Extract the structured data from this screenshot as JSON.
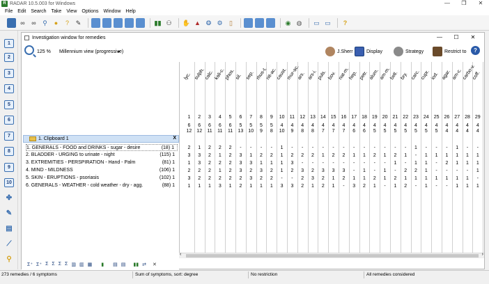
{
  "app": {
    "title": "RADAR 10.5.003 for Windows",
    "minimize": "—",
    "maximize": "❐",
    "close": "✕"
  },
  "menu": [
    "File",
    "Edit",
    "Search",
    "Take",
    "View",
    "Options",
    "Window",
    "Help"
  ],
  "window": {
    "title": "Investigation window for remedies",
    "minimize": "—",
    "maximize": "☐",
    "close": "✕"
  },
  "tools": {
    "zoom": "125 %",
    "view_mode": "Millennium view (progressive)",
    "view_caret": "▾",
    "user": "J.Sherr",
    "display": "Display",
    "strategy": "Strategy",
    "restrict": "Restrict to",
    "help": "?"
  },
  "left_numbers": [
    "1",
    "2",
    "3",
    "4",
    "5",
    "6",
    "7",
    "8",
    "9",
    "10"
  ],
  "clipboard": {
    "title": "1. Clipboard 1",
    "close": "X",
    "rubrics": [
      {
        "text": "1. GENERALS - FOOD and DRINKS - sugar - desire",
        "count": "(18) 1"
      },
      {
        "text": "2. BLADDER - URGING to urinate - night",
        "count": "(115) 1"
      },
      {
        "text": "3. EXTREMITIES - PERSPIRATION - Hand - Palm",
        "count": "(81) 1"
      },
      {
        "text": "4. MIND - MILDNESS",
        "count": "(106) 1"
      },
      {
        "text": "5. SKIN - ERUPTIONS - psoriasis",
        "count": "(102) 1"
      },
      {
        "text": "6. GENERALS - WEATHER - cold weather - dry - agg.",
        "count": "(88) 1"
      }
    ]
  },
  "remedies": [
    "lyc.",
    "sulph.",
    "calc.",
    "kali-c.",
    "phos.",
    "sil.",
    "sep.",
    "rhus-t.",
    "nit-ac.",
    "caust.",
    "mur-ac.",
    "ars.",
    "ars-i.",
    "puls.",
    "bov.",
    "nat-m.",
    "hep.",
    "petr.",
    "alum.",
    "am-m.",
    "bell.",
    "bry.",
    "carc.",
    "cupr.",
    "iod.",
    "agar.",
    "am-c.",
    "carbo-v.",
    "coff."
  ],
  "rank": [
    "1",
    "2",
    "3",
    "4",
    "5",
    "6",
    "7",
    "8",
    "9",
    "10",
    "11",
    "12",
    "13",
    "14",
    "15",
    "16",
    "17",
    "18",
    "19",
    "20",
    "21",
    "22",
    "23",
    "24",
    "25",
    "26",
    "27",
    "28",
    "29"
  ],
  "sum_symptoms": [
    "6",
    "6",
    "6",
    "6",
    "6",
    "5",
    "5",
    "5",
    "5",
    "4",
    "4",
    "4",
    "4",
    "4",
    "4",
    "4",
    "4",
    "4",
    "4",
    "4",
    "4",
    "4",
    "4",
    "4",
    "4",
    "4",
    "4",
    "4",
    "4"
  ],
  "sum_degrees": [
    "12",
    "12",
    "11",
    "11",
    "11",
    "13",
    "10",
    "9",
    "8",
    "10",
    "9",
    "8",
    "8",
    "7",
    "7",
    "7",
    "6",
    "6",
    "5",
    "5",
    "5",
    "5",
    "5",
    "5",
    "5",
    "4",
    "4",
    "4",
    "4"
  ],
  "grid": [
    [
      "2",
      "1",
      "2",
      "2",
      "2",
      "-",
      "-",
      "-",
      "-",
      "1",
      "-",
      "-",
      "-",
      "-",
      "-",
      "-",
      "-",
      "-",
      "-",
      "-",
      "-",
      "-",
      "1",
      "-",
      "-",
      "-",
      "1",
      "-",
      "-"
    ],
    [
      "3",
      "3",
      "2",
      "1",
      "2",
      "3",
      "1",
      "2",
      "2",
      "1",
      "2",
      "2",
      "2",
      "1",
      "2",
      "2",
      "1",
      "1",
      "2",
      "1",
      "2",
      "1",
      "-",
      "1",
      "1",
      "1",
      "1",
      "1",
      "1"
    ],
    [
      "1",
      "3",
      "2",
      "2",
      "2",
      "3",
      "3",
      "1",
      "1",
      "1",
      "3",
      "-",
      "-",
      "-",
      "-",
      "-",
      "-",
      "-",
      "-",
      "-",
      "1",
      "-",
      "1",
      "1",
      "-",
      "2",
      "1",
      "1",
      "1"
    ],
    [
      "2",
      "2",
      "2",
      "1",
      "2",
      "3",
      "2",
      "3",
      "2",
      "1",
      "2",
      "3",
      "2",
      "3",
      "3",
      "3",
      "-",
      "1",
      "-",
      "1",
      "-",
      "2",
      "2",
      "1",
      "-",
      "-",
      "-",
      "-",
      "1"
    ],
    [
      "3",
      "2",
      "2",
      "2",
      "2",
      "2",
      "3",
      "2",
      "2",
      "-",
      "-",
      "2",
      "3",
      "2",
      "1",
      "2",
      "1",
      "1",
      "2",
      "1",
      "2",
      "1",
      "1",
      "1",
      "1",
      "1",
      "1",
      "1",
      "-"
    ],
    [
      "1",
      "1",
      "1",
      "3",
      "1",
      "2",
      "1",
      "1",
      "1",
      "3",
      "3",
      "2",
      "1",
      "2",
      "1",
      "-",
      "3",
      "2",
      "1",
      "-",
      "1",
      "2",
      "-",
      "1",
      "-",
      "-",
      "1",
      "1",
      "1"
    ]
  ],
  "status": {
    "remedies": "273 remedies / 6 symptoms",
    "sort": "Sum of symptoms, sort: degree",
    "restriction": "No restriction",
    "considered": "All remedies considered"
  }
}
